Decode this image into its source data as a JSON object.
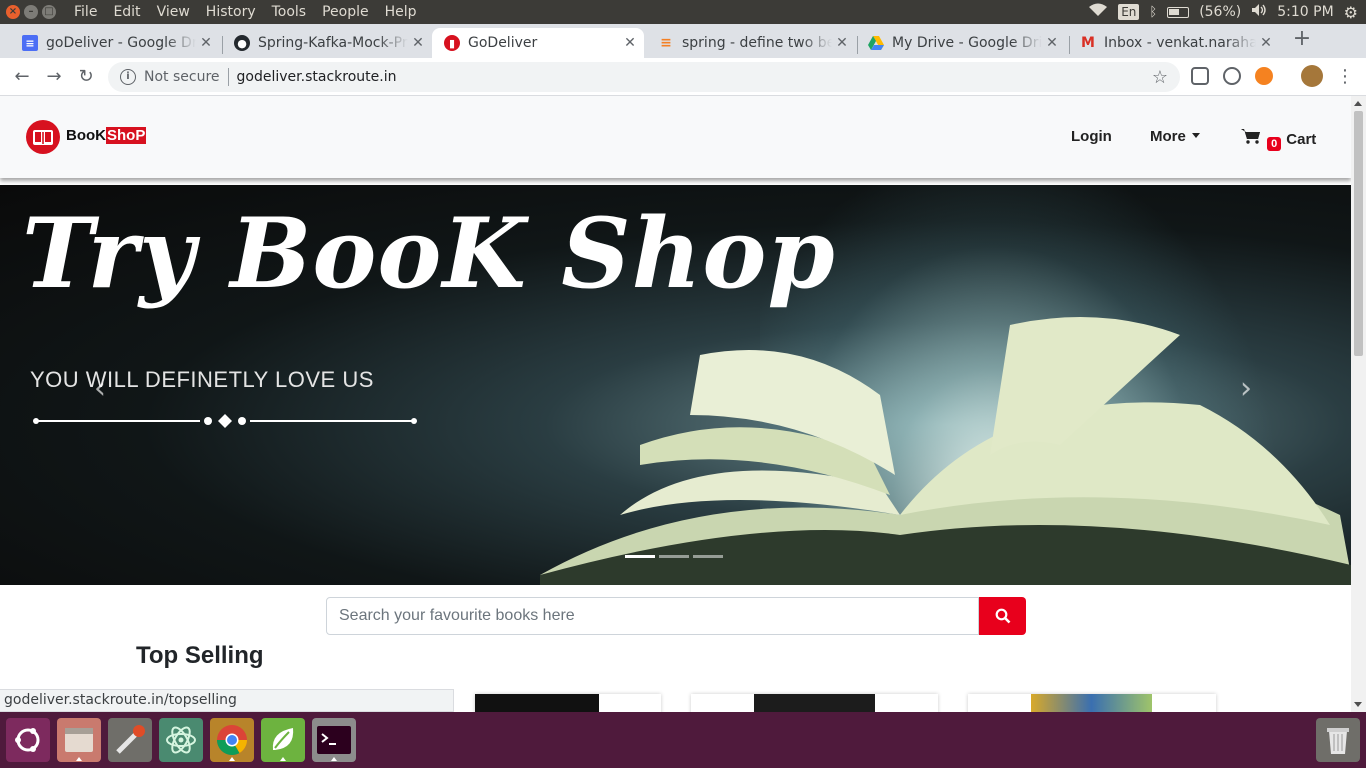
{
  "os": {
    "menu": [
      "File",
      "Edit",
      "View",
      "History",
      "Tools",
      "People",
      "Help"
    ],
    "lang": "En",
    "battery": "(56%)",
    "battery_level": 0.56,
    "clock": "5:10 PM",
    "icons": [
      "wifi-icon",
      "bluetooth-icon",
      "battery-icon",
      "volume-icon",
      "settings-gear-icon"
    ]
  },
  "tabs": [
    {
      "title": "goDeliver - Google Dr",
      "favicon": "google-docs-icon",
      "color": "#4c6ef5",
      "active": false
    },
    {
      "title": "Spring-Kafka-Mock-Pr",
      "favicon": "github-icon",
      "color": "#24292e",
      "active": false
    },
    {
      "title": "GoDeliver",
      "favicon": "godeliver-icon",
      "color": "#d7111f",
      "active": true
    },
    {
      "title": "spring - define two be",
      "favicon": "stackoverflow-icon",
      "color": "#f48024",
      "active": false
    },
    {
      "title": "My Drive - Google Driv",
      "favicon": "google-drive-icon",
      "color": "#1fa463",
      "active": false
    },
    {
      "title": "Inbox - venkat.naraha",
      "favicon": "gmail-icon",
      "color": "#d93025",
      "active": false
    }
  ],
  "toolbar": {
    "not_secure": "Not secure",
    "url": "godeliver.stackroute.in"
  },
  "site": {
    "logo_part1": "BooK",
    "logo_part2": "ShoP",
    "nav": {
      "login": "Login",
      "more": "More",
      "cart_count": "0",
      "cart": "Cart"
    },
    "hero": {
      "title": "Try BooK Shop",
      "subtitle": "YOU WILL DEFINETLY LOVE US",
      "prev": "‹",
      "next": "›"
    },
    "search": {
      "placeholder": "Search your favourite books here"
    },
    "top_selling": "Top Selling"
  },
  "status_url": "godeliver.stackroute.in/topselling",
  "colors": {
    "brand_red": "#d7111f",
    "launcher": "#4f1a3c"
  }
}
